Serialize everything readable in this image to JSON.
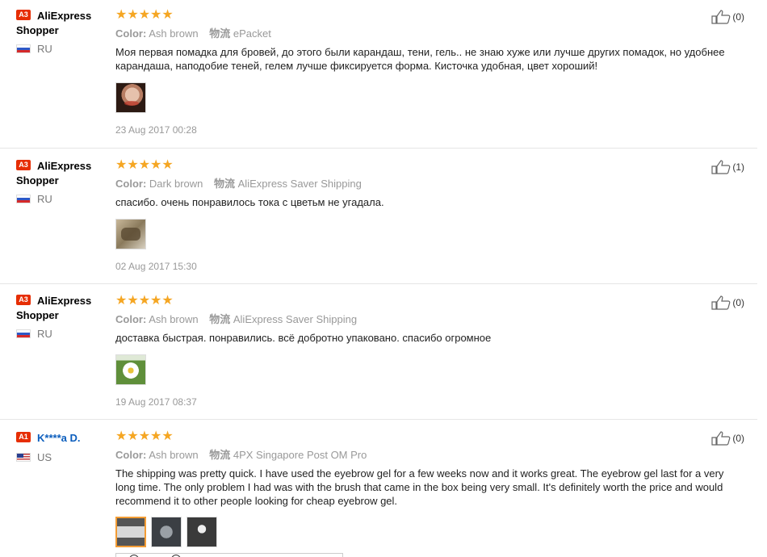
{
  "reviews": [
    {
      "level": "A3",
      "user_line1": "AliExpress",
      "user_line2": "Shopper",
      "country": "RU",
      "stars": "★★★★★",
      "color_label": "Color:",
      "color_value": "Ash brown",
      "shipping_label": "物流",
      "shipping_value": "ePacket",
      "text": "Моя первая помадка для бровей, до этого были карандаш, тени, гель.. не знаю хуже или лучше других помадок, но удобнее карандаша, наподобие теней, гелем лучше фиксируется форма. Кисточка удобная, цвет хороший!",
      "date": "23 Aug 2017 00:28",
      "helpful": "(0)"
    },
    {
      "level": "A3",
      "user_line1": "AliExpress",
      "user_line2": "Shopper",
      "country": "RU",
      "stars": "★★★★★",
      "color_label": "Color:",
      "color_value": "Dark brown",
      "shipping_label": "物流",
      "shipping_value": "AliExpress Saver Shipping",
      "text": "спасибо. очень понравилось тока с цветьм не угадала.",
      "date": "02 Aug 2017 15:30",
      "helpful": "(1)"
    },
    {
      "level": "A3",
      "user_line1": "AliExpress",
      "user_line2": "Shopper",
      "country": "RU",
      "stars": "★★★★★",
      "color_label": "Color:",
      "color_value": "Ash brown",
      "shipping_label": "物流",
      "shipping_value": "AliExpress Saver Shipping",
      "text": "доставка быстрая. понравились. всё добротно упаковано. спасибо огромное",
      "date": "19 Aug 2017 08:37",
      "helpful": "(0)"
    },
    {
      "level": "A1",
      "user_line1": "K****a D.",
      "user_line2": "",
      "country": "US",
      "stars": "★★★★★",
      "color_label": "Color:",
      "color_value": "Ash brown",
      "shipping_label": "物流",
      "shipping_value": "4PX Singapore Post OM Pro",
      "text": "The shipping was pretty quick. I have used the eyebrow gel for a few weeks now and it works great. The eyebrow gel last for a very long time. The only problem I had was with the brush that came in the box being very small. It's definitely worth the price and would recommend it to other people looking for cheap eyebrow gel.",
      "date": "",
      "helpful": "(0)"
    }
  ],
  "colors": {
    "level_badge": "#e62e04",
    "stars": "#f5a623",
    "user_link": "#0c5ebd",
    "active_thumb_border": "#f39c34"
  },
  "icons": {
    "helpful": "thumbs-up-icon",
    "flag_ru": "russia-flag-icon",
    "flag_us": "usa-flag-icon"
  }
}
